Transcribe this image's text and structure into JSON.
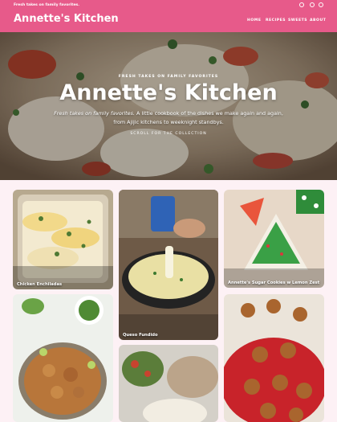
{
  "header": {
    "tagline": "Fresh takes on family favorites.",
    "brand": "Annette's Kitchen",
    "nav": [
      "HOME",
      "RECIPES",
      "SWEETS",
      "ABOUT"
    ],
    "social": [
      "instagram-icon",
      "pinterest-icon",
      "facebook-icon"
    ]
  },
  "hero": {
    "eyebrow": "FRESH TAKES ON FAMILY FAVORITES",
    "title": "Annette's Kitchen",
    "desc_italic": "Fresh takes on family favorites.",
    "desc_rest_1": " A little cookbook of the dishes we make again and again,",
    "desc_rest_2": "from Ajijic kitchens to weeknight standbys.",
    "cta": "SCROLL FOR THE COLLECTION"
  },
  "recipes": [
    {
      "label": "Chicken Enchiladas"
    },
    {
      "label": "Queso Fundido"
    },
    {
      "label": "Annette's Sugar Cookies w Lemon Zest"
    },
    {
      "label": ""
    },
    {
      "label": ""
    },
    {
      "label": ""
    }
  ],
  "colors": {
    "accent": "#e75a8a",
    "page_bg": "#fdf1f5"
  }
}
